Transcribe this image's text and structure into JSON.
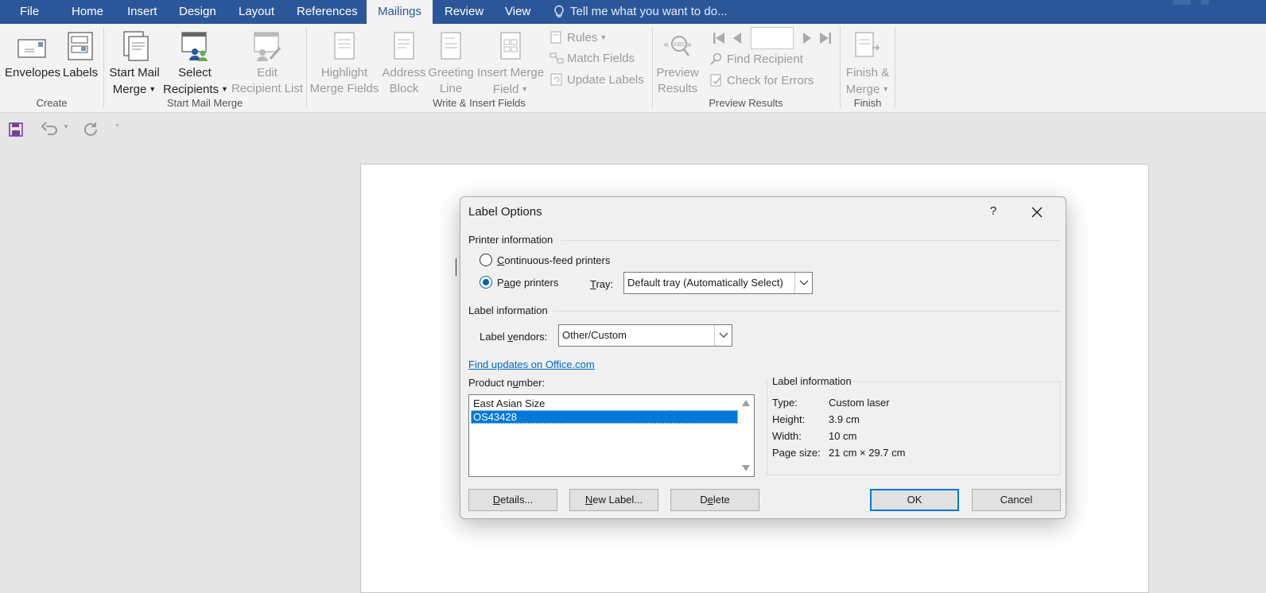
{
  "tabs": {
    "file": "File",
    "home": "Home",
    "insert": "Insert",
    "design": "Design",
    "layout": "Layout",
    "references": "References",
    "mailings": "Mailings",
    "review": "Review",
    "view": "View",
    "tell_me": "Tell me what you want to do..."
  },
  "ribbon": {
    "envelopes": "Envelopes",
    "labels": "Labels",
    "start_mail_1": "Start Mail",
    "start_mail_2": "Merge",
    "select_1": "Select",
    "select_2": "Recipients",
    "edit_1": "Edit",
    "edit_2": "Recipient List",
    "highlight_1": "Highlight",
    "highlight_2": "Merge Fields",
    "address_1": "Address",
    "address_2": "Block",
    "greeting_1": "Greeting",
    "greeting_2": "Line",
    "insert_1": "Insert Merge",
    "insert_2": "Field",
    "rules": "Rules",
    "match_fields": "Match Fields",
    "update_labels": "Update Labels",
    "preview_1": "Preview",
    "preview_2": "Results",
    "find_recipient": "Find Recipient",
    "check_errors": "Check for Errors",
    "finish_1": "Finish &",
    "finish_2": "Merge",
    "group_create": "Create",
    "group_start": "Start Mail Merge",
    "group_write": "Write & Insert Fields",
    "group_preview": "Preview Results",
    "group_finish": "Finish",
    "accent_color": "#2b579a"
  },
  "dialog": {
    "title": "Label Options",
    "help": "?",
    "printer_info": "Printer information",
    "continuous_a": "C",
    "continuous_b": "ontinuous-feed printers",
    "page_a": "P",
    "page_b": "a",
    "page_c": "ge printers",
    "tray_a": "T",
    "tray_b": "ray:",
    "tray_value": "Default tray (Automatically Select)",
    "label_info": "Label information",
    "vendors_a": "Label ",
    "vendors_b": "v",
    "vendors_c": "endors:",
    "vendor_value": "Other/Custom",
    "find_updates": "Find updates on Office.com",
    "product_a": "Product n",
    "product_b": "u",
    "product_c": "mber:",
    "products": [
      "East Asian Size",
      "OS43428"
    ],
    "info_title": "Label information",
    "type_k": "Type:",
    "type_v": "Custom laser",
    "height_k": "Height:",
    "height_v": "3.9 cm",
    "width_k": "Width:",
    "width_v": "10 cm",
    "pagesize_k": "Page size:",
    "pagesize_v": "21 cm × 29.7 cm",
    "details_a": "D",
    "details_b": "etails...",
    "new_a": "N",
    "new_b": "ew Label...",
    "delete_a": "D",
    "delete_b": "e",
    "delete_c": "lete",
    "ok": "OK",
    "cancel": "Cancel"
  }
}
